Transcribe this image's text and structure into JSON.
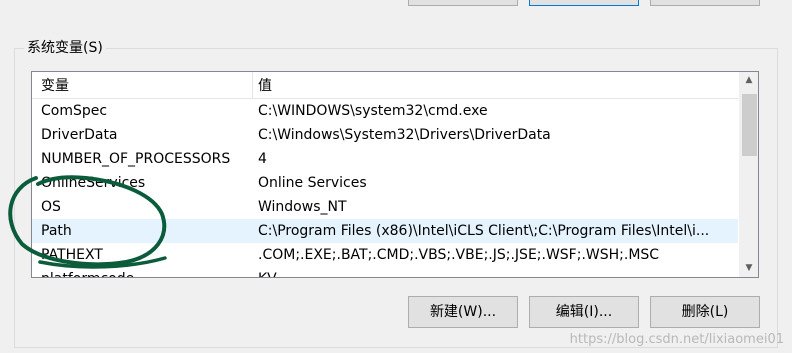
{
  "section": {
    "title": "系统变量(S)"
  },
  "table": {
    "headers": {
      "name": "变量",
      "value": "值"
    },
    "rows": [
      {
        "name": "ComSpec",
        "value": "C:\\WINDOWS\\system32\\cmd.exe"
      },
      {
        "name": "DriverData",
        "value": "C:\\Windows\\System32\\Drivers\\DriverData"
      },
      {
        "name": "NUMBER_OF_PROCESSORS",
        "value": "4"
      },
      {
        "name": "OnlineServices",
        "value": "Online Services"
      },
      {
        "name": "OS",
        "value": "Windows_NT"
      },
      {
        "name": "Path",
        "value": "C:\\Program Files (x86)\\Intel\\iCLS Client\\;C:\\Program Files\\Intel\\i..."
      },
      {
        "name": "PATHEXT",
        "value": ".COM;.EXE;.BAT;.CMD;.VBS;.VBE;.JS;.JSE;.WSF;.WSH;.MSC"
      },
      {
        "name": "platformcode",
        "value": "KV"
      }
    ]
  },
  "buttons": {
    "new": "新建(W)...",
    "edit": "编辑(I)...",
    "delete": "删除(L)"
  },
  "scrollbar": {
    "up_icon": "triangle-up",
    "down_icon": "triangle-down"
  },
  "watermark": "https://blog.csdn.net/lixiaomei01",
  "colors": {
    "ink": "#0a5c3a",
    "hover_row": "#e5f3ff",
    "button_bg": "#e1e1e1"
  }
}
